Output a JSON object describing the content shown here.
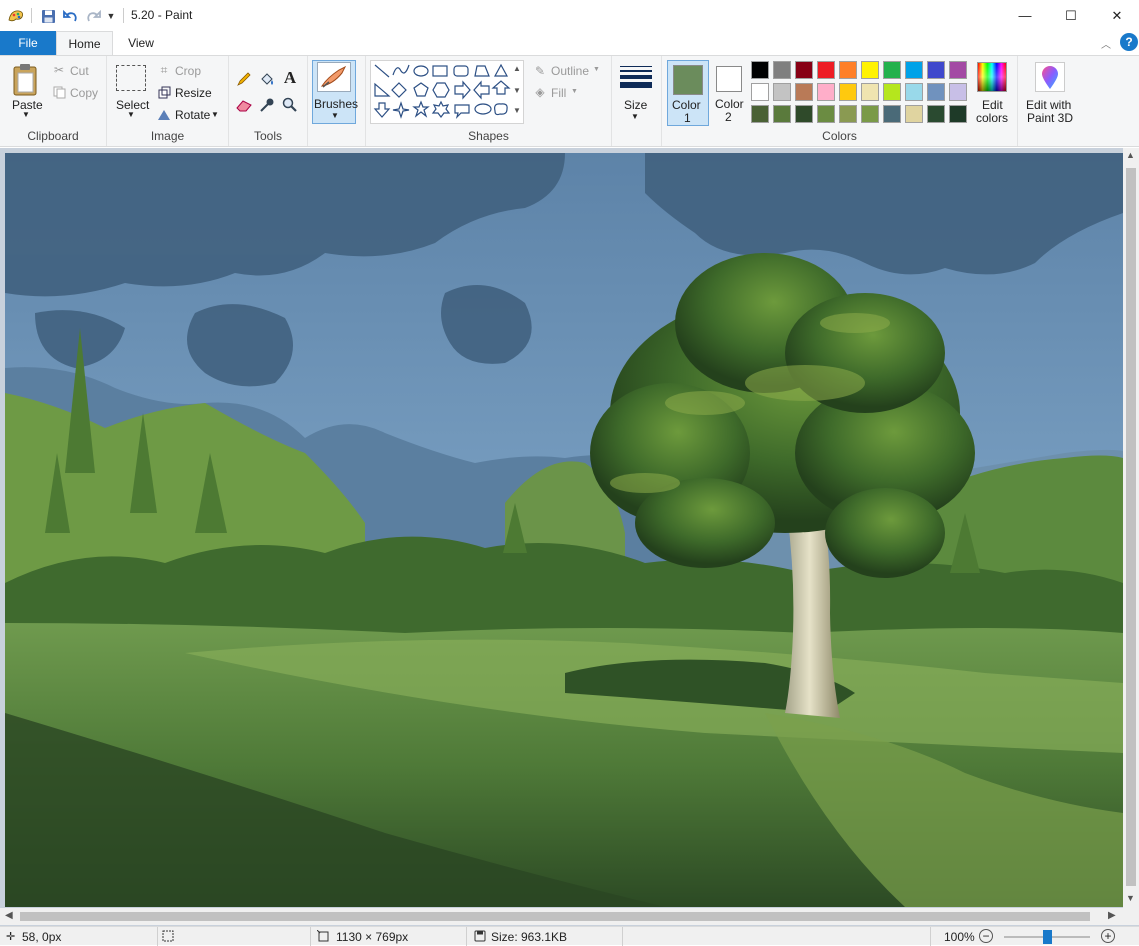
{
  "window": {
    "title": "5.20 - Paint"
  },
  "titlebar_buttons": {
    "minimize": "—",
    "maximize": "☐",
    "close": "✕"
  },
  "menu_tabs": {
    "file": "File",
    "home": "Home",
    "view": "View"
  },
  "ribbon": {
    "clipboard": {
      "group": "Clipboard",
      "paste": "Paste",
      "cut": "Cut",
      "copy": "Copy"
    },
    "image": {
      "group": "Image",
      "select": "Select",
      "crop": "Crop",
      "resize": "Resize",
      "rotate": "Rotate"
    },
    "tools": {
      "group": "Tools"
    },
    "brushes": {
      "label": "Brushes"
    },
    "shapes": {
      "group": "Shapes",
      "outline": "Outline",
      "fill": "Fill"
    },
    "size": {
      "label": "Size"
    },
    "colors": {
      "group": "Colors",
      "color1_line1": "Color",
      "color1_line2": "1",
      "color2_line1": "Color",
      "color2_line2": "2",
      "edit_colors_line1": "Edit",
      "edit_colors_line2": "colors",
      "color1_value": "#6b8c5c",
      "color2_value": "#ffffff",
      "palette": [
        [
          "#000000",
          "#7f7f7f",
          "#880015",
          "#ed1c24",
          "#ff7f27",
          "#fff200",
          "#22b14c",
          "#00a2e8",
          "#3f48cc",
          "#a349a4"
        ],
        [
          "#ffffff",
          "#c3c3c3",
          "#b97a57",
          "#ffaec9",
          "#ffc90e",
          "#efe4b0",
          "#b5e61d",
          "#99d9ea",
          "#7092be",
          "#c8bfe7"
        ],
        [
          "#4a6135",
          "#5a7a3c",
          "#2f4a2a",
          "#6b8c42",
          "#8a9a52",
          "#7a9a48",
          "#4a6a78",
          "#e0d4a0",
          "#2a4a30",
          "#1e3a28"
        ]
      ]
    },
    "paint3d": {
      "line1": "Edit with",
      "line2": "Paint 3D"
    }
  },
  "status": {
    "cursor": "58, 0px",
    "dimensions": "1130 × 769px",
    "size": "Size: 963.1KB",
    "zoom": "100%"
  }
}
